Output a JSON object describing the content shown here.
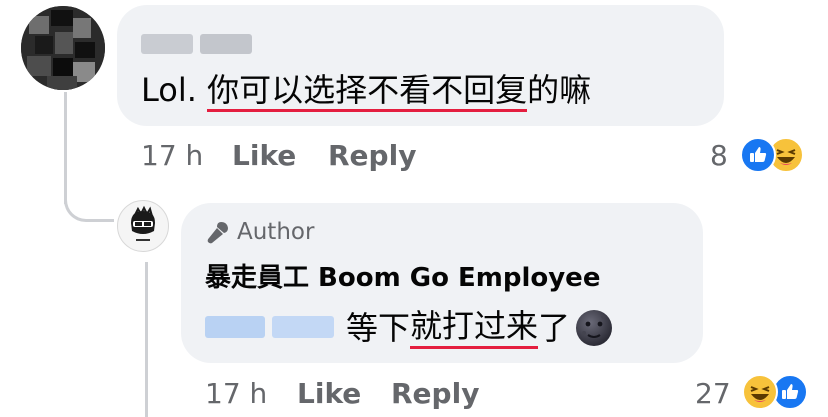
{
  "comment": {
    "text_prefix": "Lol. ",
    "text_underlined": "你可以选择不看不回复",
    "text_suffix": "的嘛",
    "time": "17 h",
    "like_label": "Like",
    "reply_label": "Reply",
    "reaction_count": "8",
    "reactions": [
      "like-icon",
      "haha-icon"
    ]
  },
  "reply": {
    "author_badge": "Author",
    "name": "暴走員工 Boom Go Employee",
    "text_plain": "等下",
    "text_underlined": "就打过来",
    "text_suffix": "了",
    "emoji": "new-moon-face-emoji",
    "time": "17 h",
    "like_label": "Like",
    "reply_label": "Reply",
    "reaction_count": "27",
    "reactions": [
      "haha-icon",
      "like-icon"
    ]
  },
  "colors": {
    "bubble": "#f0f2f5",
    "meta_text": "#65676b",
    "like_blue": "#1877f2",
    "underline_red": "#e41e3f",
    "haha_yellow": "#f7c23b"
  }
}
